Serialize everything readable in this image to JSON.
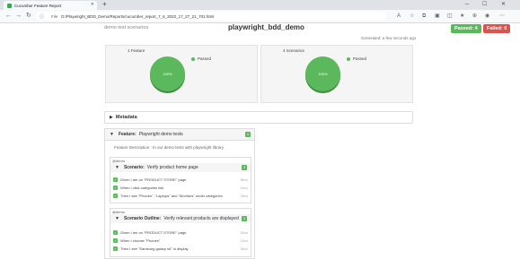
{
  "browser": {
    "tab_title": "Cucumber Feature Report",
    "address_prefix": "File",
    "url": "D:/Playwright_BDD_Demo/Reports/cucumber_report_7_6_2022_17_27_21_701.html"
  },
  "report": {
    "scenario_label": "demo test scenarios",
    "project_name": "playwright_bdd_demo",
    "passed_label": "Passed: 4",
    "failed_label": "Failed: 0",
    "generated_text": "Generated: a few seconds ago",
    "colors": {
      "passed": "#5cb85c",
      "failed": "#d9534f"
    }
  },
  "charts": {
    "features": {
      "caption": "1 Feature",
      "pie_label": "100%",
      "legend": "Passed"
    },
    "scenarios": {
      "caption": "4 Scenarios",
      "pie_label": "100%",
      "legend": "Passed"
    }
  },
  "chart_data": [
    {
      "type": "pie",
      "title": "1 Feature",
      "categories": [
        "Passed"
      ],
      "values": [
        100
      ]
    },
    {
      "type": "pie",
      "title": "4 Scenarios",
      "categories": [
        "Passed"
      ],
      "values": [
        100
      ]
    }
  ],
  "metadata": {
    "title": "Metadata"
  },
  "feature": {
    "keyword": "Feature:",
    "name": "Playwright demo tests",
    "count": "4",
    "description": "Feature Description : In our demo tests with playwright library",
    "scenarios": [
      {
        "tag": "@demo",
        "keyword": "Scenario:",
        "name": "Verify product home page",
        "count": "3",
        "steps": [
          {
            "text": "Given I am on \"PRODUCT STORE\" page",
            "time": "55ms"
          },
          {
            "text": "When I click categories link",
            "time": "10ms"
          },
          {
            "text": "Then I see \"Phones\", \"Laptops\" and \"Monitors\" under categories",
            "time": "15ms"
          }
        ]
      },
      {
        "tag": "@demo",
        "keyword": "Scenario Outline:",
        "name": "Verify relevant products are displayed",
        "count": "3",
        "steps": [
          {
            "text": "Given I am on \"PRODUCT STORE\" page",
            "time": "30ms"
          },
          {
            "text": "When I choose \"Phones\"",
            "time": "12ms"
          },
          {
            "text": "Then I see \"Samsung galaxy s6\" in display",
            "time": "18ms"
          }
        ]
      }
    ]
  }
}
